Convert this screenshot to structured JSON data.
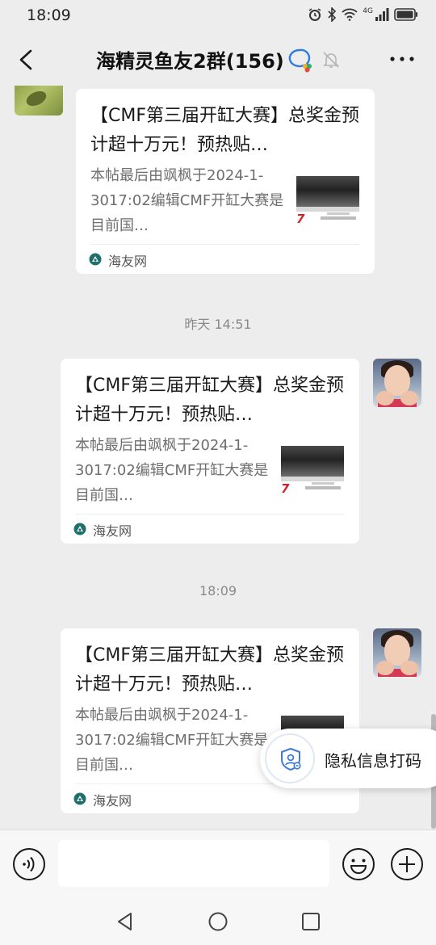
{
  "status_bar": {
    "time": "18:09",
    "network_label": "4G"
  },
  "header": {
    "title": "海精灵鱼友2群(156)"
  },
  "messages": [
    {
      "title": "【CMF第三届开缸大赛】总奖金预计超十万元！预热贴…",
      "desc": "本帖最后由飒枫于2024-1-3017:02编辑CMF开缸大赛是目前国…",
      "source": "海友网"
    },
    {
      "title": "【CMF第三届开缸大赛】总奖金预计超十万元！预热贴…",
      "desc": "本帖最后由飒枫于2024-1-3017:02编辑CMF开缸大赛是目前国…",
      "source": "海友网"
    },
    {
      "title": "【CMF第三届开缸大赛】总奖金预计超十万元！预热贴…",
      "desc": "本帖最后由飒枫于2024-1-3017:02编辑CMF开缸大赛是目前国…",
      "source": "海友网"
    }
  ],
  "timestamps": [
    "昨天 14:51",
    "18:09"
  ],
  "thumbnail_mark": "7",
  "privacy_button": {
    "label": "隐私信息打码"
  },
  "input": {
    "value": ""
  },
  "colors": {
    "background": "#ededed",
    "card": "#ffffff",
    "source_icon": "#1f6f6a",
    "privacy_icon": "#3f7ad6"
  }
}
